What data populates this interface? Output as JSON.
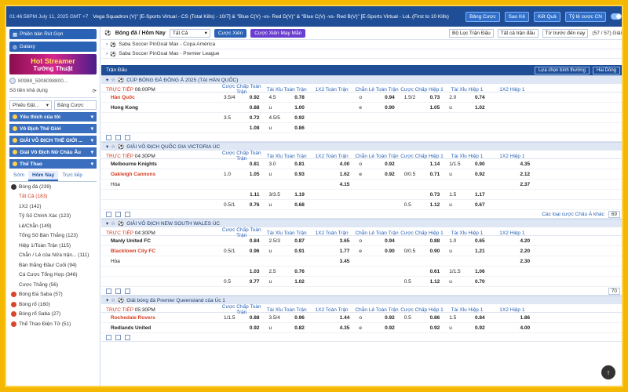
{
  "topbar": {
    "time": "01:46:58PM July 11, 2025 GMT +7",
    "ticker": "Vega Squadron (V)\" [E-Sports Virtual - CS (Total Kills) - 10/7] & \"Blue C(V) -vs- Red D(V)\" & \"Blue C(V) -vs- Red B(V)\" [E-Sports Virtual - LoL (First to 10 Kills)",
    "buttons": [
      "Bảng Cược",
      "Sao Kê",
      "Kết Quả",
      "Tỷ lệ cược CN"
    ]
  },
  "sidebar": {
    "btn1": "Phiên bản Rút Gọn",
    "btn2": "Galaxy",
    "banner1": "Hot Streamer",
    "banner2": "Tường Thuật",
    "account": "80988_5908098800...",
    "balance_label": "Số tiền khả dụng",
    "select1": "Phiếu Đặt...",
    "select2": "Bảng Cược",
    "categories": [
      {
        "label": "Yêu thích của tôi",
        "count": ""
      },
      {
        "label": "Vô Địch Thế Giới",
        "count": ""
      },
      {
        "label": "GIẢI VÔ ĐỊCH THẾ GIỚI ...",
        "count": ""
      },
      {
        "label": "Giải Vô Địch Nữ Châu Âu",
        "count": ""
      },
      {
        "label": "Thể Thao",
        "count": ""
      }
    ],
    "tabs": [
      "Sớm",
      "Hôm Nay",
      "Trực tiếp"
    ],
    "sports": [
      {
        "label": "Bóng đá (239)",
        "type": "top"
      },
      {
        "label": "Tất Cả (183)",
        "type": "active"
      },
      {
        "label": "1X2 (142)",
        "type": "sub"
      },
      {
        "label": "Tỷ Số Chính Xác (123)",
        "type": "sub"
      },
      {
        "label": "Lẻ/Chẵn (149)",
        "type": "sub"
      },
      {
        "label": "Tổng Số Bàn Thắng (123)",
        "type": "sub"
      },
      {
        "label": "Hiệp 1/Toàn Trận (115)",
        "type": "sub"
      },
      {
        "label": "Chẵn / Lẻ của Nửa trận... (111)",
        "type": "sub"
      },
      {
        "label": "Bàn thắng Đầu/ Cuối (94)",
        "type": "sub"
      },
      {
        "label": "Cá Cược Tổng Hợp (346)",
        "type": "sub"
      },
      {
        "label": "Cược Thắng (56)",
        "type": "sub"
      },
      {
        "label": "Bóng Đá Saba (57)",
        "type": "top"
      },
      {
        "label": "Bóng rổ (160)",
        "type": "top"
      },
      {
        "label": "Bóng rổ Saba (27)",
        "type": "top"
      },
      {
        "label": "Thể Thao Điện Tử (51)",
        "type": "top"
      }
    ]
  },
  "main": {
    "title": "Bóng đá / Hôm Nay",
    "filter": "Tất Cả",
    "pill1": "Cược Xiên",
    "pill2": "Cược Xiên May Mắn",
    "right_filters": [
      "Bộ Lọc Trận Đấu",
      "Tất cả trận đấu",
      "Từ trước đến nay"
    ],
    "count": "(57 / 57) Giải",
    "comps": [
      "Saba Soccer PinGoal Max - Copa América",
      "Saba Soccer PinGoal Max - Premier League"
    ],
    "section": "Trận Đấu",
    "section_opt1": "Lựa chọn bình thường",
    "section_opt2": "Hai Dòng",
    "col_headers": [
      "Cược Chấp Toàn Trận",
      "Tài Xỉu Toàn Trận",
      "1X2 Toàn Trận",
      "Chẵn Lẻ Toàn Trận",
      "Cược Chấp Hiệp 1",
      "Tài Xỉu Hiệp 1",
      "1X2 Hiệp 1"
    ],
    "leagues": [
      {
        "name": "CÚP BÓNG ĐÁ ĐÔNG Á 2025 (TẠI HÀN QUỐC)",
        "status": "TRỰC TIẾP",
        "time": "06:00PM",
        "rows": [
          {
            "team": "Hàn Quốc",
            "fav": true,
            "cells": [
              [
                "3.5/4",
                "0.92"
              ],
              [
                "4.5",
                "0.78"
              ],
              [
                "",
                ""
              ],
              [
                "o",
                "0.94"
              ],
              [
                "1.5/2",
                "0.73"
              ],
              [
                "2.0",
                "0.74"
              ],
              [
                "",
                ""
              ]
            ]
          },
          {
            "team": "Hong Kong",
            "fav": false,
            "cells": [
              [
                "",
                "0.88"
              ],
              [
                "u",
                "1.00"
              ],
              [
                "",
                ""
              ],
              [
                "e",
                "0.90"
              ],
              [
                "",
                "1.05"
              ],
              [
                "u",
                "1.02"
              ],
              [
                "",
                ""
              ]
            ]
          },
          {
            "team": "",
            "fav": false,
            "cells": [
              [
                "3.5",
                "0.72"
              ],
              [
                "4.5/5",
                "0.92"
              ],
              [
                "",
                ""
              ],
              [
                "",
                ""
              ],
              [
                "",
                ""
              ],
              [
                "",
                ""
              ],
              [
                "",
                ""
              ]
            ]
          },
          {
            "team": "",
            "fav": false,
            "cells": [
              [
                "",
                "1.08"
              ],
              [
                "u",
                "0.86"
              ],
              [
                "",
                ""
              ],
              [
                "",
                ""
              ],
              [
                "",
                ""
              ],
              [
                "",
                ""
              ],
              [
                "",
                ""
              ]
            ]
          }
        ],
        "more": ""
      },
      {
        "name": "GIẢI VÔ ĐỊCH QUỐC GIA VICTORIA ÚC",
        "status": "TRỰC TIẾP",
        "time": "04:30PM",
        "rows": [
          {
            "team": "Melbourne Knights",
            "fav": false,
            "cells": [
              [
                "",
                "0.81"
              ],
              [
                "3.0",
                "0.81"
              ],
              [
                "",
                "4.00"
              ],
              [
                "o",
                "0.92"
              ],
              [
                "",
                "1.14"
              ],
              [
                "1/1.5",
                "0.90"
              ],
              [
                "",
                "4.35"
              ]
            ]
          },
          {
            "team": "Oakleigh Cannons",
            "fav": true,
            "cells": [
              [
                "1.0",
                "1.05"
              ],
              [
                "u",
                "0.93"
              ],
              [
                "",
                "1.62"
              ],
              [
                "e",
                "0.92"
              ],
              [
                "0/0.5",
                "0.71"
              ],
              [
                "u",
                "0.92"
              ],
              [
                "",
                "2.12"
              ]
            ]
          },
          {
            "team": "Hòa",
            "fav": false,
            "draw": true,
            "cells": [
              [
                "",
                ""
              ],
              [
                "",
                ""
              ],
              [
                "",
                "4.15"
              ],
              [
                "",
                ""
              ],
              [
                "",
                ""
              ],
              [
                "",
                ""
              ],
              [
                "",
                "2.37"
              ]
            ]
          },
          {
            "team": "",
            "fav": false,
            "cells": [
              [
                "",
                "1.11"
              ],
              [
                "3/3.5",
                "1.19"
              ],
              [
                "",
                ""
              ],
              [
                "",
                ""
              ],
              [
                "",
                "0.73"
              ],
              [
                "1.5",
                "1.17"
              ],
              [
                "",
                ""
              ]
            ]
          },
          {
            "team": "",
            "fav": false,
            "cells": [
              [
                "0.5/1",
                "0.76"
              ],
              [
                "u",
                "0.68"
              ],
              [
                "",
                ""
              ],
              [
                "",
                ""
              ],
              [
                "0.5",
                "1.12"
              ],
              [
                "u",
                "0.67"
              ],
              [
                "",
                ""
              ]
            ]
          }
        ],
        "more": "Các loại cược Châu Á khác"
      },
      {
        "name": "GIẢI VÔ ĐỊCH NEW SOUTH WALES ÚC",
        "status": "TRỰC TIẾP",
        "time": "04:30PM",
        "rows": [
          {
            "team": "Manly United FC",
            "fav": false,
            "cells": [
              [
                "",
                "0.84"
              ],
              [
                "2.5/3",
                "0.87"
              ],
              [
                "",
                "3.65"
              ],
              [
                "o",
                "0.94"
              ],
              [
                "",
                "0.88"
              ],
              [
                "1.0",
                "0.65"
              ],
              [
                "",
                "4.20"
              ]
            ]
          },
          {
            "team": "Blacktown City FC",
            "fav": true,
            "cells": [
              [
                "0.5/1",
                "0.96"
              ],
              [
                "u",
                "0.91"
              ],
              [
                "",
                "1.77"
              ],
              [
                "e",
                "0.90"
              ],
              [
                "0/0.5",
                "0.90"
              ],
              [
                "u",
                "1.21"
              ],
              [
                "",
                "2.20"
              ]
            ]
          },
          {
            "team": "Hòa",
            "fav": false,
            "draw": true,
            "cells": [
              [
                "",
                ""
              ],
              [
                "",
                ""
              ],
              [
                "",
                "3.45"
              ],
              [
                "",
                ""
              ],
              [
                "",
                ""
              ],
              [
                "",
                ""
              ],
              [
                "",
                "2.30"
              ]
            ]
          },
          {
            "team": "",
            "fav": false,
            "cells": [
              [
                "",
                "1.03"
              ],
              [
                "2.5",
                "0.76"
              ],
              [
                "",
                ""
              ],
              [
                "",
                ""
              ],
              [
                "",
                "0.61"
              ],
              [
                "1/1.5",
                "1.06"
              ],
              [
                "",
                ""
              ]
            ]
          },
          {
            "team": "",
            "fav": false,
            "cells": [
              [
                "0.5",
                "0.77"
              ],
              [
                "u",
                "1.02"
              ],
              [
                "",
                ""
              ],
              [
                "",
                ""
              ],
              [
                "0.5",
                "1.12"
              ],
              [
                "u",
                "0.70"
              ],
              [
                "",
                ""
              ]
            ]
          }
        ],
        "more": ""
      },
      {
        "name": "Giải bóng đá Premier Queensland của Úc 1",
        "status": "TRỰC TIẾP",
        "time": "05:30PM",
        "rows": [
          {
            "team": "Rochedale Rovers",
            "fav": true,
            "cells": [
              [
                "1/1.5",
                "0.88"
              ],
              [
                "3.5/4",
                "0.96"
              ],
              [
                "",
                "1.44"
              ],
              [
                "o",
                "0.92"
              ],
              [
                "0.5",
                "0.86"
              ],
              [
                "1.5",
                "0.84"
              ],
              [
                "",
                "1.86"
              ]
            ]
          },
          {
            "team": "Redlands United",
            "fav": false,
            "cells": [
              [
                "",
                "0.92"
              ],
              [
                "u",
                "0.82"
              ],
              [
                "",
                "4.35"
              ],
              [
                "e",
                "0.92"
              ],
              [
                "",
                "0.92"
              ],
              [
                "u",
                "0.92"
              ],
              [
                "",
                "4.00"
              ]
            ]
          }
        ],
        "more": ""
      }
    ],
    "page_sel_1": "69",
    "page_sel_2": "70"
  },
  "colors": {
    "brand": "#1f4e96",
    "accent": "#f5b800",
    "live": "#d63a1f"
  }
}
